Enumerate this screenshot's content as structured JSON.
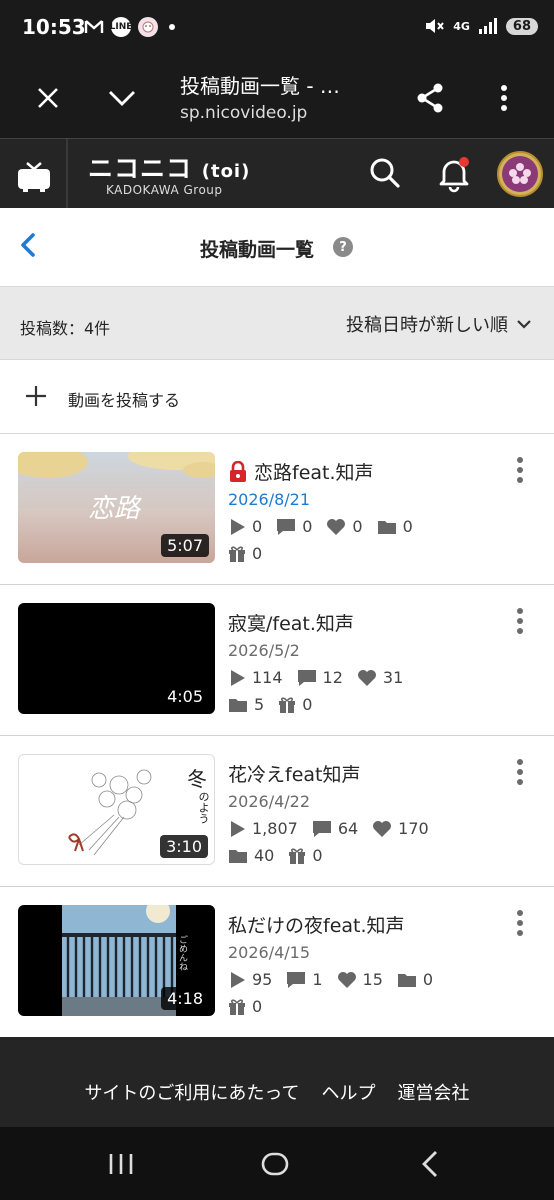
{
  "status_bar": {
    "time": "10:53",
    "left_icons": [
      "gmail-icon",
      "line-icon",
      "app-icon"
    ],
    "network": "4G",
    "battery": "68"
  },
  "browser": {
    "page_title": "投稿動画一覧 - …",
    "url": "sp.nicovideo.jp"
  },
  "app_header": {
    "logo": "ニコニコ",
    "logo_suffix": "(toi)",
    "sub": "KADOKAWA Group"
  },
  "page": {
    "title": "投稿動画一覧",
    "help": "?"
  },
  "toolbar": {
    "count_label": "投稿数：4件",
    "sort_label": "投稿日時が新しい順"
  },
  "upload": {
    "label": "動画を投稿する"
  },
  "videos": [
    {
      "title": "恋路feat.知声",
      "locked": true,
      "date": "2026/8/21",
      "duration": "5:07",
      "views": "0",
      "comments": "0",
      "likes": "0",
      "mylists": "0",
      "gifts": "0",
      "thumb_text": "恋路"
    },
    {
      "title": "寂寞/feat.知声",
      "locked": false,
      "date": "2026/5/2",
      "duration": "4:05",
      "views": "114",
      "comments": "12",
      "likes": "31",
      "mylists": "5",
      "gifts": "0"
    },
    {
      "title": "花冷えfeat知声",
      "locked": false,
      "date": "2026/4/22",
      "duration": "3:10",
      "views": "1,807",
      "comments": "64",
      "likes": "170",
      "mylists": "40",
      "gifts": "0",
      "thumb_text": "冬",
      "thumb_text2": "のよう"
    },
    {
      "title": "私だけの夜feat.知声",
      "locked": false,
      "date": "2026/4/15",
      "duration": "4:18",
      "views": "95",
      "comments": "1",
      "likes": "15",
      "mylists": "0",
      "gifts": "0",
      "thumb_text": "ごめんね"
    }
  ],
  "footer": {
    "links": [
      "サイトのご利用にあたって",
      "ヘルプ",
      "運営会社"
    ]
  },
  "colors": {
    "accent_blue": "#1f7ad1",
    "lock_red": "#d6262c",
    "header_bg": "#252525"
  }
}
